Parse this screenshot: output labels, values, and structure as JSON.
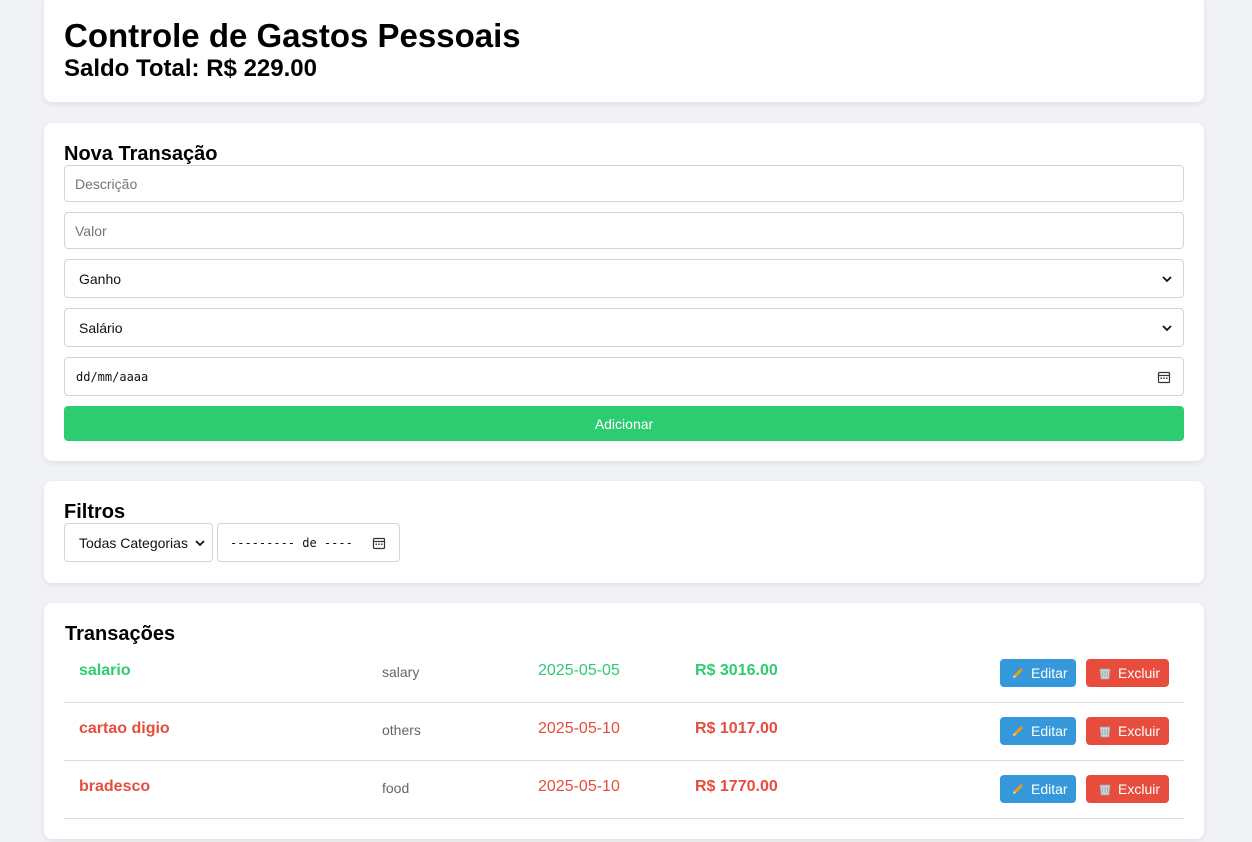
{
  "header": {
    "title": "Controle de Gastos Pessoais",
    "balance_label": "Saldo Total: R$ 229.00"
  },
  "form": {
    "title": "Nova Transação",
    "description_placeholder": "Descrição",
    "value_placeholder": "Valor",
    "type_selected": "Ganho",
    "category_selected": "Salário",
    "date_placeholder": "dd/mm/aaaa",
    "submit_label": "Adicionar"
  },
  "filters": {
    "title": "Filtros",
    "category_selected": "Todas Categorias",
    "month_placeholder": "--------- de ----"
  },
  "transactions": {
    "title": "Transações",
    "edit_label": "Editar",
    "delete_label": "Excluir",
    "items": [
      {
        "description": "salario",
        "category": "salary",
        "date": "2025-05-05",
        "amount": "R$ 3016.00",
        "type": "gain"
      },
      {
        "description": "cartao digio",
        "category": "others",
        "date": "2025-05-10",
        "amount": "R$ 1017.00",
        "type": "loss"
      },
      {
        "description": "bradesco",
        "category": "food",
        "date": "2025-05-10",
        "amount": "R$ 1770.00",
        "type": "loss"
      }
    ]
  },
  "colors": {
    "background": "#f0f2f5",
    "gain": "#2ecc71",
    "loss": "#e74c3c",
    "edit_button": "#3498db",
    "delete_button": "#e74c3c",
    "add_button": "#2ecc71"
  },
  "icons": {
    "edit": "pencil-icon",
    "delete": "wastebasket-icon",
    "calendar": "calendar-icon",
    "select": "chevron-down-icon"
  }
}
